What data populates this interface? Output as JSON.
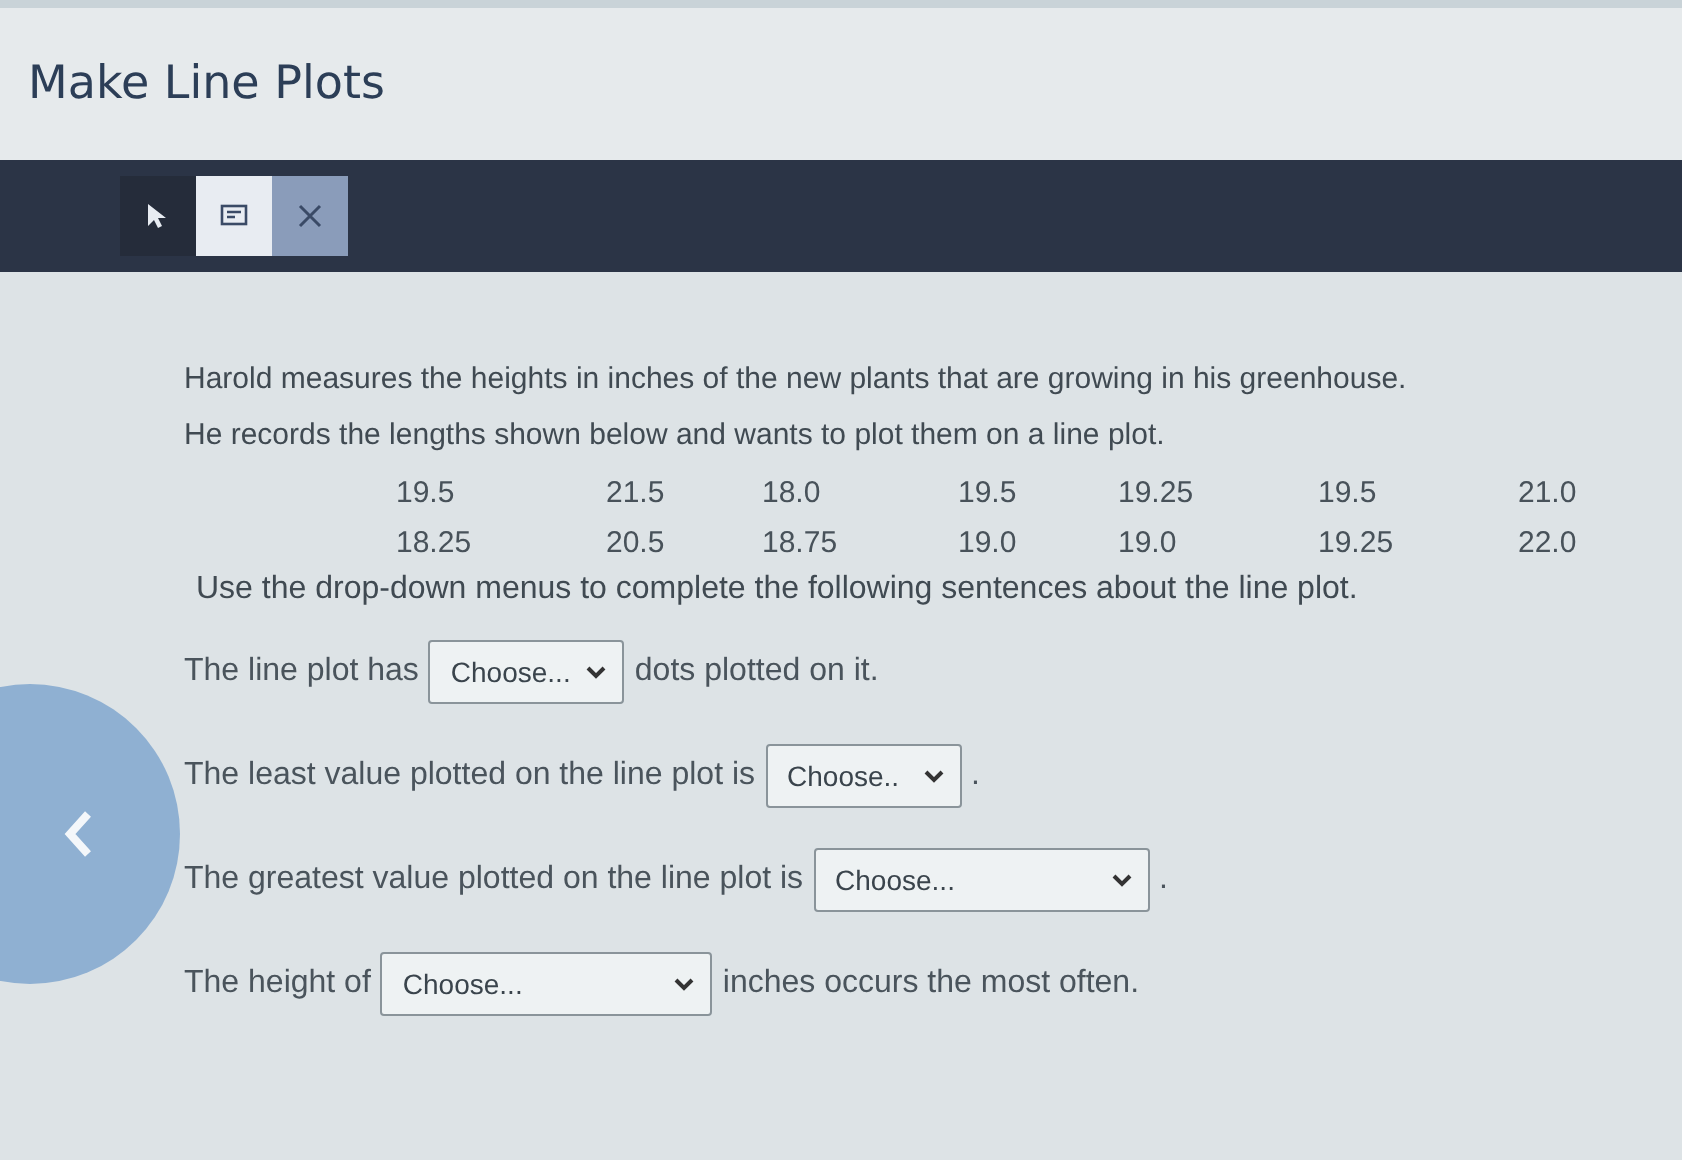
{
  "title": "Make Line Plots",
  "toolbar": [
    {
      "kind": "pointer",
      "selected": true
    },
    {
      "kind": "notes",
      "selected": false
    },
    {
      "kind": "close",
      "selected": false
    }
  ],
  "question": {
    "intro": [
      "Harold measures the heights in inches of the new plants that are growing in his greenhouse.",
      "He records the lengths shown below and wants to plot them on a line plot."
    ],
    "data_rows": [
      [
        "19.5",
        "21.5",
        "18.0",
        "19.5",
        "19.25",
        "19.5",
        "21.0"
      ],
      [
        "18.25",
        "20.5",
        "18.75",
        "19.0",
        "19.0",
        "19.25",
        "22.0"
      ]
    ],
    "instruction": "Use the drop-down menus to complete the following sentences about the line plot.",
    "sentences": [
      {
        "before": "The line plot has",
        "choice": "Choose...",
        "after": "dots plotted on it."
      },
      {
        "before": "The least value plotted on the line plot is",
        "choice": "Choose..",
        "after": "."
      },
      {
        "before": "The greatest value plotted on the line plot is",
        "choice": "Choose...",
        "after": "."
      },
      {
        "before": "The height of",
        "choice": "Choose...",
        "after": "inches occurs the most often."
      }
    ]
  }
}
